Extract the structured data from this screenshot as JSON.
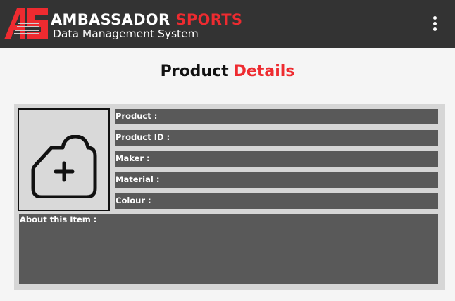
{
  "header": {
    "brand_primary": "AMBASSADOR",
    "brand_secondary": "SPORTS",
    "subtitle": "Data Management System",
    "logo_icon": "as-monogram-logo",
    "menu_icon": "more-vertical-icon"
  },
  "page": {
    "title_primary": "Product",
    "title_accent": "Details"
  },
  "product": {
    "image_placeholder_icon": "add-photo-icon",
    "fields": [
      {
        "label": "Product :",
        "value": ""
      },
      {
        "label": "Product ID :",
        "value": ""
      },
      {
        "label": "Maker :",
        "value": ""
      },
      {
        "label": "Material :",
        "value": ""
      },
      {
        "label": "Colour :",
        "value": ""
      }
    ],
    "about": {
      "label": "About this Item :",
      "value": ""
    }
  },
  "colors": {
    "appbar": "#333333",
    "accent": "#ee2b30",
    "field_bg": "#595959",
    "card_bg": "#d6d6d6",
    "page_bg": "#f5f5f5"
  }
}
